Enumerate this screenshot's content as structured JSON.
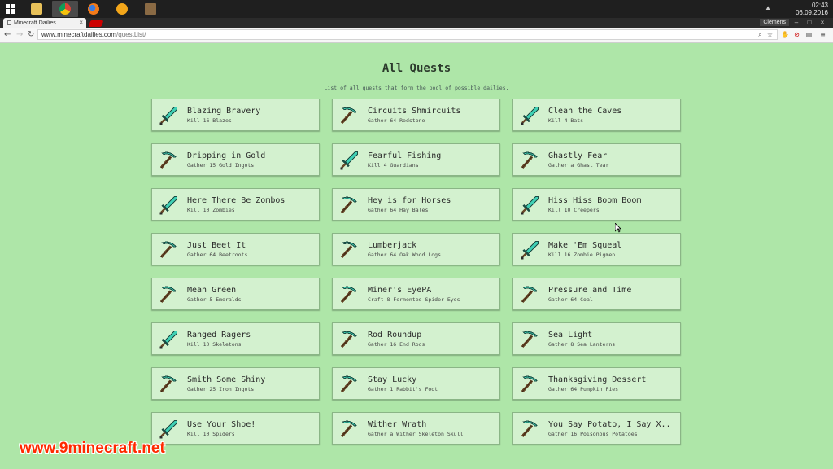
{
  "taskbar": {
    "time": "02:43",
    "date": "06.09.2016",
    "apps": [
      "file-explorer-icon",
      "chrome-icon",
      "firefox-icon",
      "audio-player-icon",
      "minecraft-icon"
    ]
  },
  "browser": {
    "tab_title": "Minecraft Dailies",
    "profile": "Clemens",
    "url_host": "www.minecraftdailies.com",
    "url_path": "/questList/"
  },
  "page": {
    "title": "All Quests",
    "subtitle": "List of all quests that form the pool of possible dailies."
  },
  "quests": [
    {
      "name": "Blazing Bravery",
      "desc": "Kill 16 Blazes",
      "icon": "sword"
    },
    {
      "name": "Circuits Shmircuits",
      "desc": "Gather 64 Redstone",
      "icon": "pickaxe"
    },
    {
      "name": "Clean the Caves",
      "desc": "Kill 4 Bats",
      "icon": "sword"
    },
    {
      "name": "Dripping in Gold",
      "desc": "Gather 15 Gold Ingots",
      "icon": "pickaxe"
    },
    {
      "name": "Fearful Fishing",
      "desc": "Kill 4 Guardians",
      "icon": "sword"
    },
    {
      "name": "Ghastly Fear",
      "desc": "Gather a Ghast Tear",
      "icon": "pickaxe"
    },
    {
      "name": "Here There Be Zombos",
      "desc": "Kill 10 Zombies",
      "icon": "sword"
    },
    {
      "name": "Hey is for Horses",
      "desc": "Gather 64 Hay Bales",
      "icon": "pickaxe"
    },
    {
      "name": "Hiss Hiss Boom Boom",
      "desc": "Kill 10 Creepers",
      "icon": "sword"
    },
    {
      "name": "Just Beet It",
      "desc": "Gather 64 Beetroots",
      "icon": "pickaxe"
    },
    {
      "name": "Lumberjack",
      "desc": "Gather 64 Oak Wood Logs",
      "icon": "pickaxe"
    },
    {
      "name": "Make 'Em Squeal",
      "desc": "Kill 16 Zombie Pigmen",
      "icon": "sword"
    },
    {
      "name": "Mean Green",
      "desc": "Gather 5 Emeralds",
      "icon": "pickaxe"
    },
    {
      "name": "Miner's EyePA",
      "desc": "Craft 8 Fermented Spider Eyes",
      "icon": "pickaxe"
    },
    {
      "name": "Pressure and Time",
      "desc": "Gather 64 Coal",
      "icon": "pickaxe"
    },
    {
      "name": "Ranged Ragers",
      "desc": "Kill 10 Skeletons",
      "icon": "sword"
    },
    {
      "name": "Rod Roundup",
      "desc": "Gather 16 End Rods",
      "icon": "pickaxe"
    },
    {
      "name": "Sea Light",
      "desc": "Gather 8 Sea Lanterns",
      "icon": "pickaxe"
    },
    {
      "name": "Smith Some Shiny",
      "desc": "Gather 25 Iron Ingots",
      "icon": "pickaxe"
    },
    {
      "name": "Stay Lucky",
      "desc": "Gather 1 Rabbit's Foot",
      "icon": "pickaxe"
    },
    {
      "name": "Thanksgiving Dessert",
      "desc": "Gather 64 Pumpkin Pies",
      "icon": "pickaxe"
    },
    {
      "name": "Use Your Shoe!",
      "desc": "Kill 10 Spiders",
      "icon": "sword"
    },
    {
      "name": "Wither Wrath",
      "desc": "Gather a Wither Skeleton Skull",
      "icon": "pickaxe"
    },
    {
      "name": "You Say Potato, I Say X..",
      "desc": "Gather 16 Poisonous Potatoes",
      "icon": "pickaxe"
    }
  ],
  "watermark": "www.9minecraft.net",
  "colors": {
    "page_bg": "#aee6a8",
    "card_bg": "#d3f1cf",
    "diamond": "#3fd1b5",
    "handle": "#6b4a2a"
  }
}
